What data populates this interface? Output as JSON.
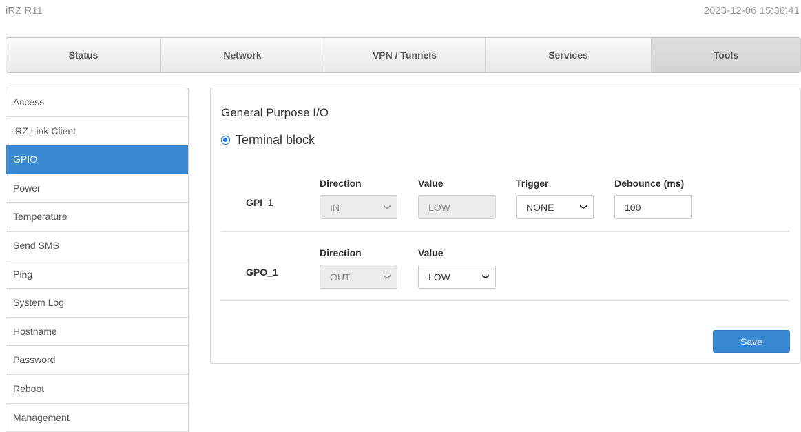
{
  "header": {
    "device_name": "iRZ R11",
    "datetime": "2023-12-06 15:38:41"
  },
  "nav": {
    "tabs": [
      {
        "label": "Status"
      },
      {
        "label": "Network"
      },
      {
        "label": "VPN / Tunnels"
      },
      {
        "label": "Services"
      },
      {
        "label": "Tools",
        "active": true
      }
    ]
  },
  "sidebar": {
    "items": [
      {
        "label": "Access"
      },
      {
        "label": "iRZ Link Client"
      },
      {
        "label": "GPIO",
        "active": true
      },
      {
        "label": "Power"
      },
      {
        "label": "Temperature"
      },
      {
        "label": "Send SMS"
      },
      {
        "label": "Ping"
      },
      {
        "label": "System Log"
      },
      {
        "label": "Hostname"
      },
      {
        "label": "Password"
      },
      {
        "label": "Reboot"
      },
      {
        "label": "Management"
      }
    ]
  },
  "main": {
    "title": "General Purpose I/O",
    "mode_label": "Terminal block",
    "gpi": {
      "name": "GPI_1",
      "direction_label": "Direction",
      "direction_value": "IN",
      "value_label": "Value",
      "value_value": "LOW",
      "trigger_label": "Trigger",
      "trigger_value": "NONE",
      "debounce_label": "Debounce (ms)",
      "debounce_value": "100"
    },
    "gpo": {
      "name": "GPO_1",
      "direction_label": "Direction",
      "direction_value": "OUT",
      "value_label": "Value",
      "value_value": "LOW"
    },
    "save_label": "Save"
  },
  "colors": {
    "accent": "#3a88d1",
    "radio": "#1a73e8"
  }
}
